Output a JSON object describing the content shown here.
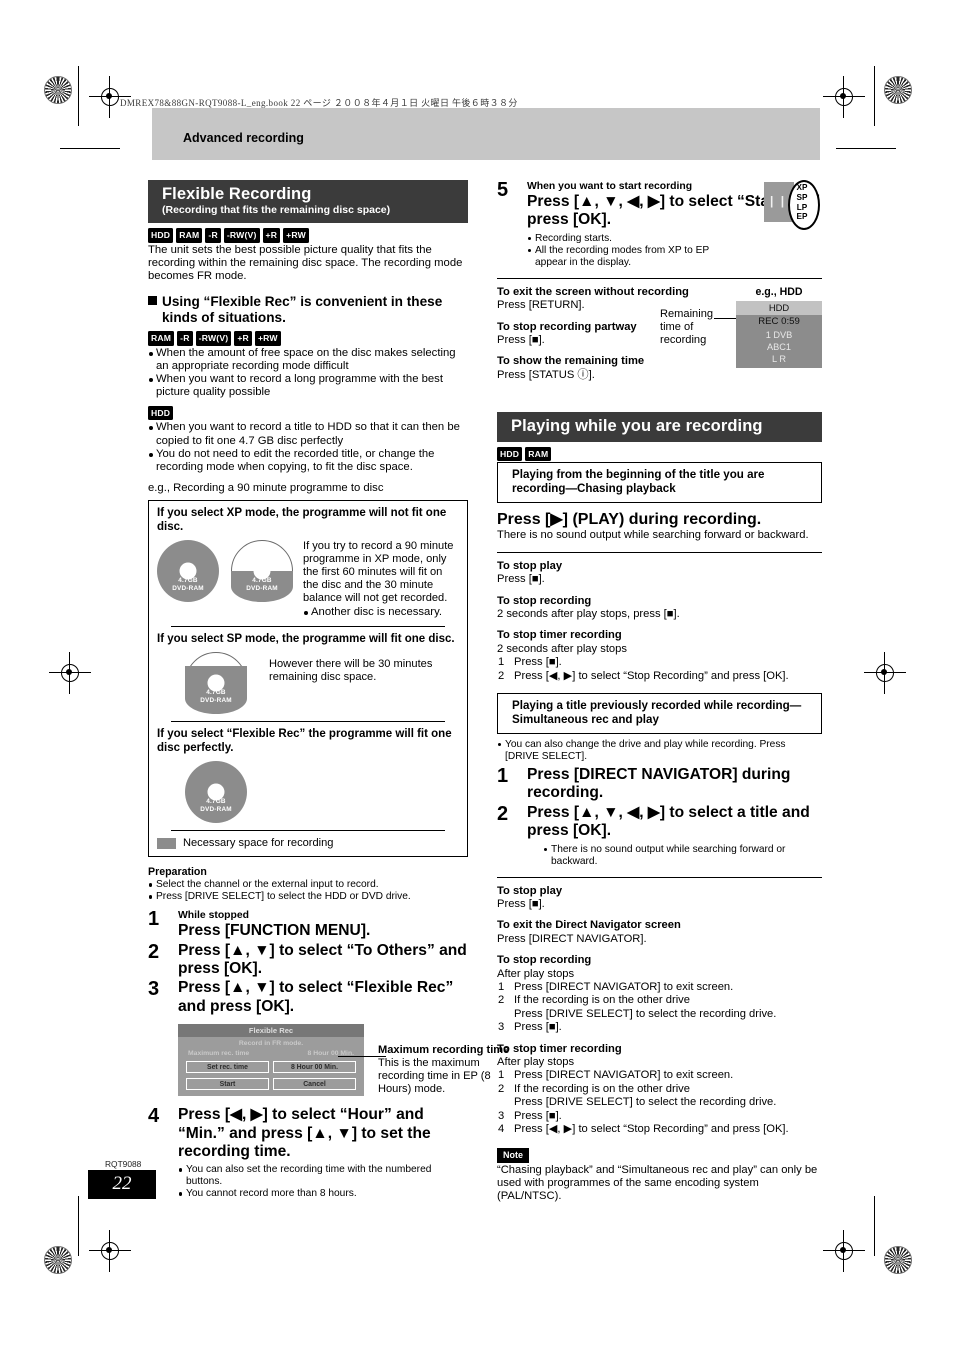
{
  "page": {
    "file_header": "DMREX78&88GN-RQT9088-L_eng.book   22 ページ   ２００８年４月１日   火曜日   午後６時３８分",
    "chapter": "Advanced recording",
    "footer_code": "RQT9088",
    "page_number": "22"
  },
  "flexible": {
    "title": "Flexible Recording",
    "subtitle": "(Recording that fits the remaining disc space)",
    "badges": [
      "HDD",
      "RAM",
      "-R",
      "-RW(V)",
      "+R",
      "+RW"
    ],
    "intro": "The unit sets the best possible picture quality that fits the recording within the remaining disc space. The recording mode becomes FR mode.",
    "using_heading_l1": "Using “Flexible Rec” is convenient in these",
    "using_heading_l2": "kinds of situations.",
    "badges2": [
      "RAM",
      "-R",
      "-RW(V)",
      "+R",
      "+RW"
    ],
    "bullets2": [
      "When the amount of free space on the disc makes selecting an appropriate recording mode difficult",
      "When you want to record a long programme with the best picture quality possible"
    ],
    "badges3": [
      "HDD"
    ],
    "bullets3": [
      "When you want to record a title to HDD so that it can then be copied to fit one 4.7 GB disc perfectly",
      "You do not need to edit the recorded title, or change the recording mode when copying, to fit the disc space."
    ],
    "eg": "e.g., Recording a 90 minute programme to disc"
  },
  "disc_panel": {
    "xp_heading": "If you select XP mode, the programme will not fit one disc.",
    "xp_caption": "If you try to record a 90 minute programme in XP mode, only the first 60 minutes will fit on the disc and the 30 minute balance will not get recorded.",
    "xp_bullet": "Another disc is necessary.",
    "sp_heading": "If you select SP mode, the programme will fit one disc.",
    "sp_caption": "However there will be 30 minutes remaining disc space.",
    "fr_heading": "If you select “Flexible Rec” the programme will fit one disc perfectly.",
    "legend": "Necessary space for recording",
    "disc_label_top": "4.7GB",
    "disc_label_bottom": "DVD-RAM"
  },
  "preparation": {
    "heading": "Preparation",
    "bullets": [
      "Select the channel or the external input to record.",
      "Press [DRIVE SELECT] to select the HDD or DVD drive."
    ]
  },
  "steps_left": [
    {
      "num": "1",
      "small": "While stopped",
      "big": "Press [FUNCTION MENU]."
    },
    {
      "num": "2",
      "small": "",
      "big": "Press [▲, ▼] to select “To Others” and press [OK]."
    },
    {
      "num": "3",
      "small": "",
      "big": "Press [▲, ▼] to select “Flexible Rec” and press [OK]."
    },
    {
      "num": "4",
      "small": "",
      "big": "Press [◀, ▶] to select “Hour” and “Min.” and press [▲, ▼] to set the recording time."
    }
  ],
  "step4_bullets": [
    "You can also set the recording time with the numbered buttons.",
    "You cannot record more than 8 hours."
  ],
  "dialog": {
    "title": "Flexible Rec",
    "line1": "Record in FR mode.",
    "max_label": "Maximum rec. time",
    "max_value": "8 Hour 00 Min.",
    "set_label": "Set rec. time",
    "set_value": "8 Hour 00 Min.",
    "start": "Start",
    "cancel": "Cancel",
    "note_title": "Maximum recording time",
    "note_body": "This is the maximum recording time in EP (8 Hours) mode."
  },
  "step5": {
    "num": "5",
    "small": "When you want to start recording",
    "big": "Press [▲, ▼, ◀, ▶] to select “Start” and press [OK].",
    "bullets": [
      "Recording starts.",
      "All the recording modes from XP to EP appear in the display."
    ],
    "display_modes": [
      "XP",
      "SP",
      "LP",
      "EP"
    ]
  },
  "exit_block": [
    {
      "head": "To exit the screen without recording",
      "body": "Press [RETURN]."
    },
    {
      "head": "To stop recording partway",
      "body": "Press [■]."
    },
    {
      "head": "To show the remaining time",
      "body": "Press [STATUS ⓘ]."
    }
  ],
  "eg_hdd": {
    "caption": "e.g., HDD",
    "remaining_label": "Remaining time of recording",
    "lines": [
      "HDD",
      "REC 0:59",
      "1 DVB",
      "ABC1",
      "L R"
    ]
  },
  "playing": {
    "title": "Playing while you are recording",
    "badges": [
      "HDD",
      "RAM"
    ],
    "box1": "Playing from the beginning of the title you are recording—Chasing playback",
    "press_play": "Press [▶] (PLAY) during recording.",
    "press_play_note": "There is no sound output while searching forward or backward.",
    "stop_blocks_1": [
      {
        "head": "To stop play",
        "body": "Press [■]."
      },
      {
        "head": "To stop recording",
        "body": "2 seconds after play stops, press [■]."
      }
    ],
    "stop_timer_1": {
      "head": "To stop timer recording",
      "sub": "2 seconds after play stops",
      "items": [
        {
          "n": "1",
          "t": "Press [■]."
        },
        {
          "n": "2",
          "t": "Press [◀, ▶] to select “Stop Recording” and press [OK]."
        }
      ]
    },
    "box2": "Playing a title previously recorded while recording—Simultaneous rec and play",
    "box2_bullet": "You can also change the drive and play while recording. Press [DRIVE SELECT].",
    "steps": [
      {
        "num": "1",
        "big": "Press [DIRECT NAVIGATOR] during recording."
      },
      {
        "num": "2",
        "big": "Press [▲, ▼, ◀, ▶] to select a title and press [OK]."
      }
    ],
    "step2_bullet": "There is no sound output while searching forward or backward.",
    "stop_blocks_2": [
      {
        "head": "To stop play",
        "body": "Press [■]."
      },
      {
        "head": "To exit the Direct Navigator screen",
        "body": "Press [DIRECT NAVIGATOR]."
      }
    ],
    "stop_recording_2": {
      "head": "To stop recording",
      "sub": "After play stops",
      "items": [
        {
          "n": "1",
          "t": "Press [DIRECT NAVIGATOR] to exit screen."
        },
        {
          "n": "2",
          "t": "If the recording is on the other drive"
        },
        {
          "n": "",
          "t": "Press [DRIVE SELECT] to select the recording drive."
        },
        {
          "n": "3",
          "t": "Press [■]."
        }
      ]
    },
    "stop_timer_2": {
      "head": "To stop timer recording",
      "sub": "After play stops",
      "items": [
        {
          "n": "1",
          "t": "Press [DIRECT NAVIGATOR] to exit screen."
        },
        {
          "n": "2",
          "t": "If the recording is on the other drive"
        },
        {
          "n": "",
          "t": "Press [DRIVE SELECT] to select the recording drive."
        },
        {
          "n": "3",
          "t": "Press [■]."
        },
        {
          "n": "4",
          "t": "Press [◀, ▶] to select “Stop Recording” and press [OK]."
        }
      ]
    },
    "note_badge": "Note",
    "note_text": "“Chasing playback” and “Simultaneous rec and play” can only be used with programmes of the same encoding system (PAL/NTSC)."
  }
}
